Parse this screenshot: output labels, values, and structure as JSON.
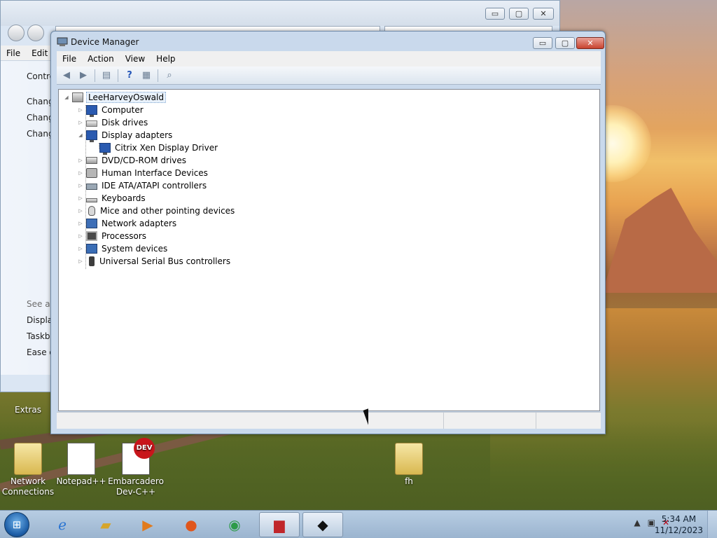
{
  "control_panel": {
    "menu": [
      "File",
      "Edit"
    ],
    "left_items": [
      "Contro",
      "Chang",
      "Chang",
      "Chang"
    ],
    "see_also_header": "See als",
    "see_also_items": [
      "Display",
      "Taskba",
      "Ease of"
    ],
    "window_buttons": {
      "minimize": "▭",
      "maximize": "▢",
      "close": "✕"
    }
  },
  "device_manager": {
    "title": "Device Manager",
    "window_buttons": {
      "minimize": "▭",
      "maximize": "▢",
      "close": "✕"
    },
    "menu": [
      "File",
      "Action",
      "View",
      "Help"
    ],
    "toolbar": [
      "back-icon",
      "forward-icon",
      "properties-icon",
      "help-icon",
      "console-icon",
      "scan-hardware-icon"
    ],
    "tree": {
      "root": "LeeHarveyOswald",
      "nodes": [
        {
          "label": "Computer",
          "icon": "computer-icon",
          "expanded": false
        },
        {
          "label": "Disk drives",
          "icon": "disk-drive-icon",
          "expanded": false
        },
        {
          "label": "Display adapters",
          "icon": "display-adapter-icon",
          "expanded": true,
          "children": [
            "Citrix Xen Display Driver"
          ]
        },
        {
          "label": "DVD/CD-ROM drives",
          "icon": "cdrom-icon",
          "expanded": false
        },
        {
          "label": "Human Interface Devices",
          "icon": "hid-icon",
          "expanded": false
        },
        {
          "label": "IDE ATA/ATAPI controllers",
          "icon": "ide-controller-icon",
          "expanded": false
        },
        {
          "label": "Keyboards",
          "icon": "keyboard-icon",
          "expanded": false
        },
        {
          "label": "Mice and other pointing devices",
          "icon": "mouse-icon",
          "expanded": false
        },
        {
          "label": "Network adapters",
          "icon": "network-adapter-icon",
          "expanded": false
        },
        {
          "label": "Processors",
          "icon": "processor-icon",
          "expanded": false
        },
        {
          "label": "System devices",
          "icon": "system-devices-icon",
          "expanded": false
        },
        {
          "label": "Universal Serial Bus controllers",
          "icon": "usb-icon",
          "expanded": false
        }
      ]
    }
  },
  "desktop_icons": [
    {
      "label": "Extras"
    },
    {
      "label": "Network Connections"
    },
    {
      "label": "Notepad++"
    },
    {
      "label": "Embarcadero Dev-C++",
      "badge": "DEV"
    },
    {
      "label": "fh"
    }
  ],
  "taskbar": {
    "start": "⊞",
    "pinned": [
      "internet-explorer-icon",
      "explorer-icon",
      "media-player-icon",
      "firefox-icon",
      "chrome-icon",
      "toolbox-icon",
      "device-manager-icon"
    ],
    "tray_arrow": "▲",
    "time": "5:34 AM",
    "date": "11/12/2023"
  }
}
